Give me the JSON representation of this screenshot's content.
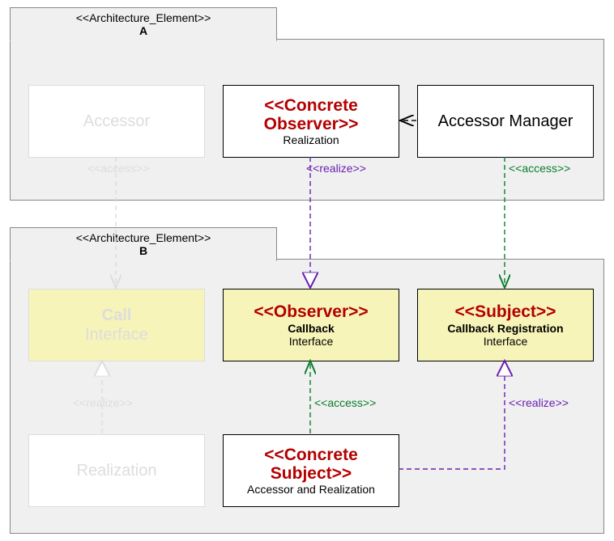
{
  "packages": {
    "A": {
      "stereotype": "<<Architecture_Element>>",
      "name": "A"
    },
    "B": {
      "stereotype": "<<Architecture_Element>>",
      "name": "B"
    }
  },
  "boxes": {
    "accessor": {
      "title": "Accessor"
    },
    "concreteObserver": {
      "stereotype": "<<Concrete Observer>>",
      "sub": "Realization"
    },
    "accessorManager": {
      "title": "Accessor Manager"
    },
    "callInterface": {
      "title1": "Call",
      "title2": "Interface"
    },
    "observer": {
      "stereotype": "<<Observer>>",
      "sub_b": "Callback",
      "sub": "Interface"
    },
    "subject": {
      "stereotype": "<<Subject>>",
      "sub_b": "Callback Registration",
      "sub": "Interface"
    },
    "realization": {
      "title": "Realization"
    },
    "concreteSubject": {
      "stereotype": "<<Concrete Subject>>",
      "sub": "Accessor and Realization"
    }
  },
  "edges": {
    "access1": "<<access>>",
    "realize1": "<<realize>>",
    "access2": "<<access>>",
    "realize2": "<<realize>>",
    "access3": "<<access>>",
    "realize3": "<<realize>>"
  }
}
